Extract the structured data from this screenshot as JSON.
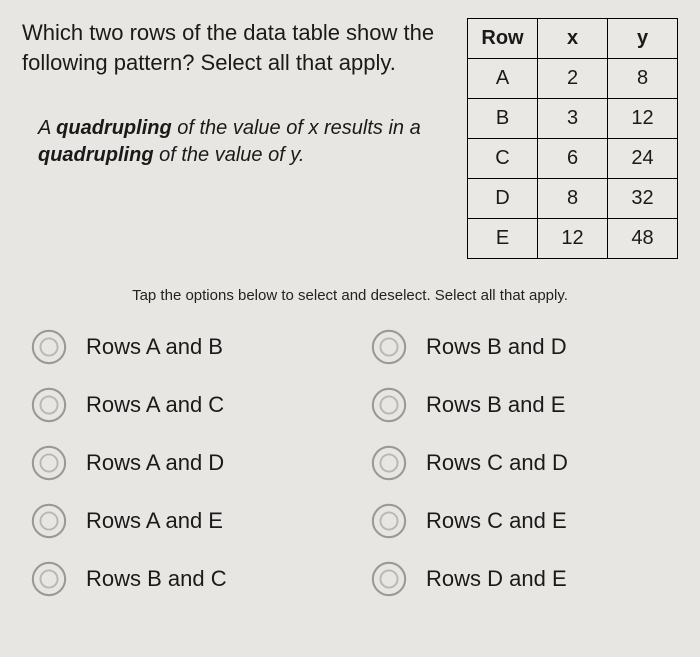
{
  "question": "Which two rows of the data table show the following pattern? Select all that apply.",
  "pattern_html": "A <b>quadrupling</b> of the value of x results in a <b>quadrupling</b> of the value of y.",
  "table": {
    "headers": [
      "Row",
      "x",
      "y"
    ],
    "rows": [
      {
        "label": "A",
        "x": "2",
        "y": "8"
      },
      {
        "label": "B",
        "x": "3",
        "y": "12"
      },
      {
        "label": "C",
        "x": "6",
        "y": "24"
      },
      {
        "label": "D",
        "x": "8",
        "y": "32"
      },
      {
        "label": "E",
        "x": "12",
        "y": "48"
      }
    ]
  },
  "instruction": "Tap the options below to select and deselect. Select all that apply.",
  "options": [
    "Rows A and B",
    "Rows A and C",
    "Rows A and D",
    "Rows A and E",
    "Rows B and C",
    "Rows B and D",
    "Rows B and E",
    "Rows C and D",
    "Rows C and E",
    "Rows D and E"
  ]
}
